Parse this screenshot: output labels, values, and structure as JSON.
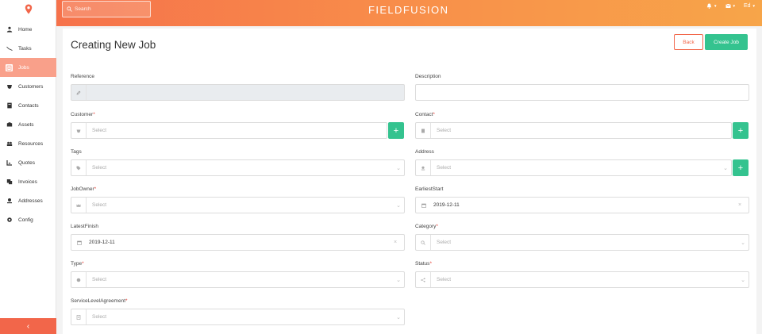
{
  "app": {
    "brand": "FIELDFUSION"
  },
  "search": {
    "placeholder": "Search"
  },
  "user": {
    "name": "Ed"
  },
  "sidebar": {
    "items": [
      {
        "label": "Home",
        "icon": "home-icon"
      },
      {
        "label": "Tasks",
        "icon": "tasks-icon"
      },
      {
        "label": "Jobs",
        "icon": "jobs-icon",
        "active": true
      },
      {
        "label": "Customers",
        "icon": "customers-icon"
      },
      {
        "label": "Contacts",
        "icon": "contacts-icon"
      },
      {
        "label": "Assets",
        "icon": "assets-icon"
      },
      {
        "label": "Resources",
        "icon": "resources-icon"
      },
      {
        "label": "Quotes",
        "icon": "quotes-icon"
      },
      {
        "label": "Invoices",
        "icon": "invoices-icon"
      },
      {
        "label": "Addresses",
        "icon": "addresses-icon"
      },
      {
        "label": "Config",
        "icon": "config-icon"
      }
    ]
  },
  "page": {
    "title": "Creating New Job",
    "back_label": "Back",
    "create_label": "Create Job"
  },
  "form": {
    "reference": {
      "label": "Reference",
      "value": ""
    },
    "description": {
      "label": "Description",
      "value": ""
    },
    "customer": {
      "label": "Customer",
      "placeholder": "Select"
    },
    "contact": {
      "label": "Contact",
      "placeholder": "Select"
    },
    "tags": {
      "label": "Tags",
      "placeholder": "Select"
    },
    "address": {
      "label": "Address",
      "placeholder": "Select"
    },
    "job_owner": {
      "label": "JobOwner",
      "placeholder": "Select"
    },
    "earliest_start": {
      "label": "EarliestStart",
      "value": "2019-12-11"
    },
    "latest_finish": {
      "label": "LatestFinish",
      "value": "2019-12-11"
    },
    "category": {
      "label": "Category",
      "placeholder": "Select"
    },
    "type": {
      "label": "Type",
      "placeholder": "Select"
    },
    "status": {
      "label": "Status",
      "placeholder": "Select"
    },
    "sla": {
      "label": "ServiceLevelAgreement",
      "placeholder": "Select"
    }
  },
  "colors": {
    "accent": "#f2664a",
    "success": "#34c38f",
    "active_nav": "#f9a08a"
  }
}
